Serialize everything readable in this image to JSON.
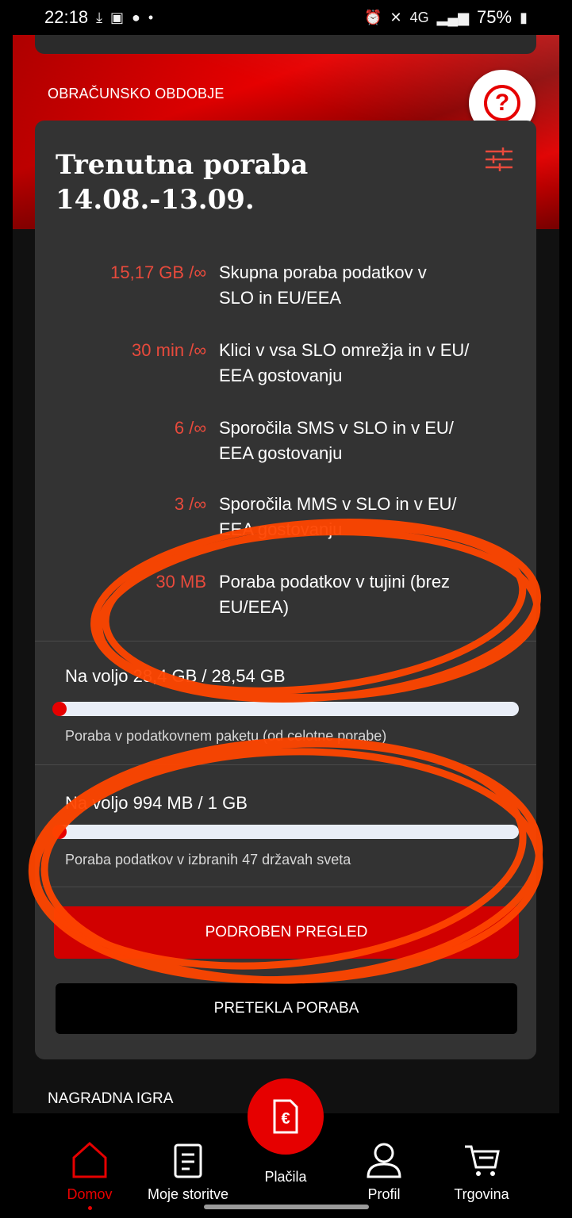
{
  "status_bar": {
    "time": "22:18",
    "network": "4G",
    "battery": "75%",
    "icons": [
      "download-icon",
      "gallery-icon",
      "messenger-icon",
      "alarm-icon",
      "mute-icon",
      "signal-icon",
      "battery-icon"
    ]
  },
  "header": {
    "section_title": "OBRAČUNSKO OBDOBJE",
    "help_symbol": "?"
  },
  "usage_card": {
    "title_line1": "Trenutna poraba",
    "title_line2": "14.08.-13.09.",
    "items": [
      {
        "value": "15,17 GB /",
        "unlimited_symbol": "∞",
        "label_line1": "Skupna poraba podatkov v",
        "label_line2": "SLO in EU/EEA"
      },
      {
        "value": "30 min /",
        "unlimited_symbol": "∞",
        "label_line1": "Klici v vsa SLO omrežja in v EU/",
        "label_line2": "EEA gostovanju"
      },
      {
        "value": "6 /",
        "unlimited_symbol": "∞",
        "label_line1": "Sporočila SMS v SLO in v EU/",
        "label_line2": "EEA gostovanju"
      },
      {
        "value": "3 /",
        "unlimited_symbol": "∞",
        "label_line1": "Sporočila MMS v SLO in v EU/",
        "label_line2": "EEA gostovanju"
      },
      {
        "value": "30 MB",
        "unlimited_symbol": "",
        "label_line1": "Poraba podatkov v tujini (brez",
        "label_line2": "EU/EEA)"
      }
    ],
    "allowances": [
      {
        "available": "Na voljo 28,4 GB / 28,54 GB",
        "used_fraction": 0.005,
        "note": "Poraba v podatkovnem paketu (od celotne porabe)"
      },
      {
        "available": "Na voljo 994 MB / 1 GB",
        "used_fraction": 0.029,
        "note": "Poraba podatkov v izbranih 47 državah sveta"
      }
    ],
    "detail_button": "PODROBEN PREGLED",
    "overage_button": "PRETEKLA PORABA"
  },
  "promo_title": "NAGRADNA IGRA",
  "bottom_nav": {
    "items": [
      {
        "label": "Domov",
        "icon": "home-icon",
        "active": true
      },
      {
        "label": "Moje storitve",
        "icon": "document-icon",
        "active": false
      },
      {
        "label": "Plačila",
        "icon": "euro-invoice-icon",
        "active": false
      },
      {
        "label": "Profil",
        "icon": "user-icon",
        "active": false
      },
      {
        "label": "Trgovina",
        "icon": "shopping-cart-icon",
        "active": false
      }
    ],
    "pay_symbol": "€"
  },
  "colors": {
    "brand_red": "#e60000",
    "usage_value": "#e84a3c",
    "card_bg": "#333333",
    "annotation": "#ff4500"
  }
}
